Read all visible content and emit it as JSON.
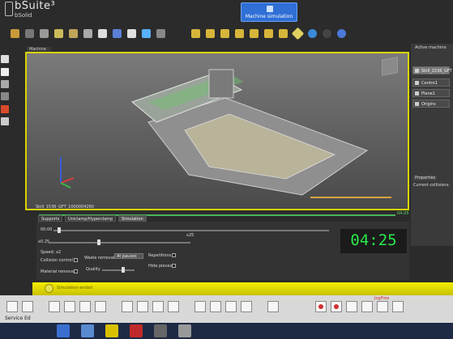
{
  "app": {
    "title": "bSuite³",
    "subtitle": "bSolid",
    "mode_button": "Machine simulation"
  },
  "viewport": {
    "tab": "Machine",
    "machine_label": "Skill_1536_GFT_1000004260"
  },
  "right_panel": {
    "title": "Active machine",
    "items": [
      "Skill_1536_GFT",
      "Centro1",
      "Plane1",
      "Origins"
    ],
    "properties_tab": "Properties",
    "current_collisions": "Current collisions:"
  },
  "bottom_tabs": [
    "Supports",
    "Uniclamp/Hyperclamp",
    "Simulation"
  ],
  "simulation": {
    "time_start": "00:00",
    "time_end": "04:25",
    "speed_min": "x0.25",
    "speed_max": "x25",
    "speed_label": "Speed: x2",
    "collision_control": "Collision control",
    "waste_removal": "Waste removal",
    "waste_option": "At pauses",
    "repetitions": "Repetitions",
    "material_removal": "Material removal",
    "quality": "Quality",
    "hide_pieces": "Hide pieces",
    "big_time": "04:25"
  },
  "status": {
    "text": "Simulation ended",
    "color": "#f4ee00"
  },
  "bottom_toolbar": {
    "service_label": "Service Ed",
    "jog_label": "JogFree"
  },
  "colors": {
    "accent": "#d8d400",
    "time_green": "#2ae84a",
    "mode_blue": "#2f6fd6"
  }
}
